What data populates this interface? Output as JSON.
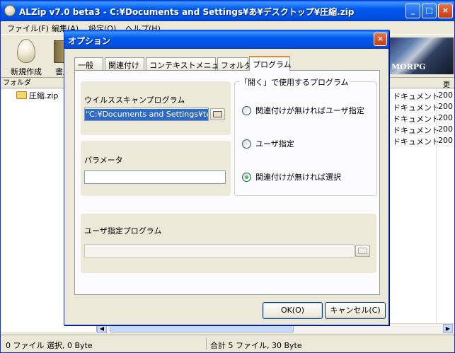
{
  "window": {
    "title": "ALZip v7.0 beta3 - C:¥Documents and Settings¥あ¥デスクトップ¥圧縮.zip",
    "min_glyph": "_",
    "max_glyph": "□",
    "close_glyph": "×"
  },
  "menu": {
    "items": [
      {
        "label": "ファイル(F)"
      },
      {
        "label": "編集(A)"
      },
      {
        "label": "設定(O)"
      },
      {
        "label": "ヘルプ(H)"
      }
    ]
  },
  "toolbar": {
    "new_label": "新規作成",
    "book_label": "書庫",
    "banner_text": "MORPG"
  },
  "folder_pane": {
    "header": "フォルダ",
    "tree_item": "圧縮.zip"
  },
  "file_list": {
    "header_partial": "更",
    "rows": [
      {
        "type": "ドキュメント",
        "date": "200"
      },
      {
        "type": "ドキュメント",
        "date": "200"
      },
      {
        "type": "ドキュメント",
        "date": "200"
      },
      {
        "type": "ドキュメント",
        "date": "200"
      },
      {
        "type": "ドキュメント",
        "date": "200"
      }
    ]
  },
  "statusbar": {
    "left": "0 ファイル 選択,  0 Byte",
    "right": "合計 5 ファイル,  30 Byte"
  },
  "dialog": {
    "title": "オプション",
    "close_glyph": "×",
    "tabs": [
      {
        "label": "一般"
      },
      {
        "label": "関連付け"
      },
      {
        "label": "コンテキストメニュー"
      },
      {
        "label": "フォルダ"
      },
      {
        "label": "プログラム"
      }
    ],
    "virus_scan": {
      "label": "ウイルススキャンプログラム",
      "value": "\"C:¥Documents and Settings¥test"
    },
    "parameter": {
      "label": "パラメータ",
      "value": ""
    },
    "open_program": {
      "legend": "「開く」で使用するプログラム",
      "options": [
        {
          "label": "関連付けが無ければユーザ指定",
          "checked": false
        },
        {
          "label": "ユーザ指定",
          "checked": false
        },
        {
          "label": "関連付けが無ければ選択",
          "checked": true
        }
      ]
    },
    "user_program": {
      "label": "ユーザ指定プログラム",
      "value": ""
    },
    "ok_label": "OK(O)",
    "cancel_label": "キャンセル(C)"
  }
}
